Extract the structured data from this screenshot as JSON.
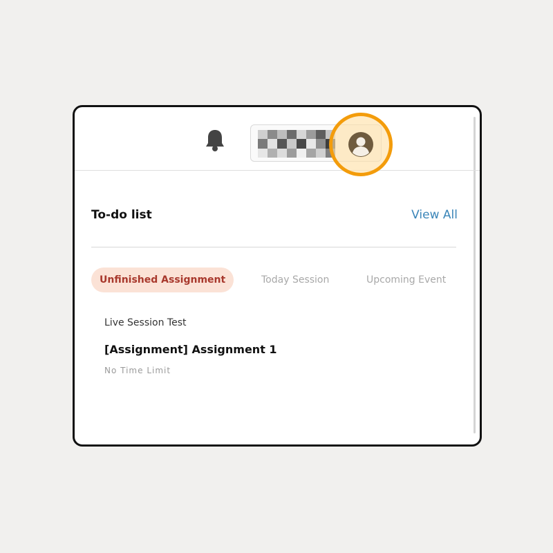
{
  "header": {
    "notifications_icon": "bell-icon",
    "profile_icon": "user-avatar-icon",
    "highlight_color": "#f39c0b"
  },
  "todo": {
    "title": "To-do list",
    "view_all": "View All",
    "tabs": [
      {
        "label": "Unfinished Assignment",
        "active": true
      },
      {
        "label": "Today Session",
        "active": false
      },
      {
        "label": "Upcoming Event",
        "active": false
      }
    ],
    "items": [
      {
        "course": "Live Session Test",
        "title": "[Assignment] Assignment 1",
        "time_limit": "No Time Limit"
      }
    ]
  },
  "colors": {
    "accent_link": "#3a85b8",
    "active_tab_bg": "#fbe2d6",
    "active_tab_text": "#a8382c"
  }
}
